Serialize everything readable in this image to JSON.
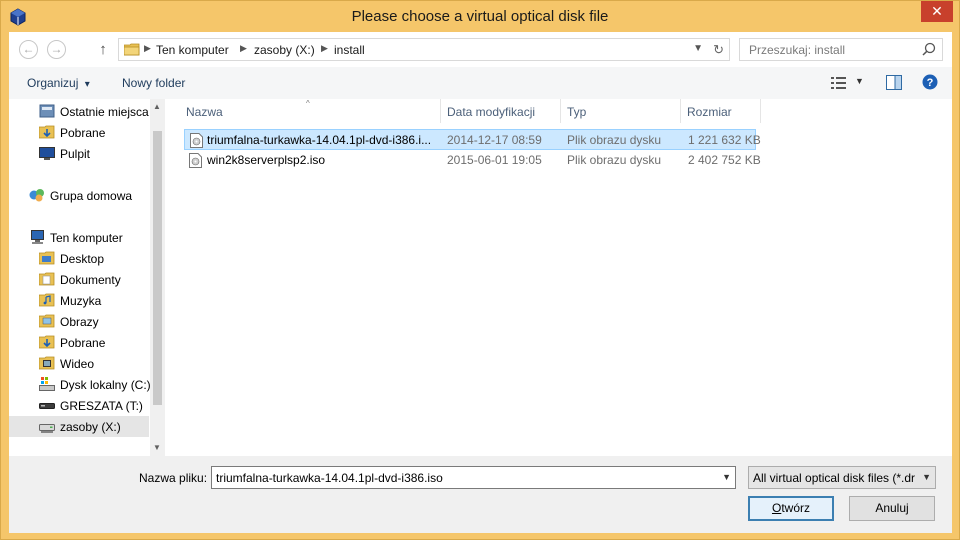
{
  "window": {
    "title": "Please choose a virtual optical disk file",
    "close_label": "✕",
    "app_icon": "virtualbox-icon"
  },
  "navigation": {
    "back_icon": "←",
    "forward_icon": "→",
    "up_icon": "↑",
    "breadcrumbs": [
      "Ten komputer",
      "zasoby (X:)",
      "install"
    ],
    "search_placeholder": "Przeszukaj: install"
  },
  "toolbar": {
    "organize_label": "Organizuj",
    "organize_caret": "▾",
    "new_folder_label": "Nowy folder"
  },
  "nav_pane": {
    "items": [
      {
        "label": "Ostatnie miejsca",
        "icon": "recent-places-icon"
      },
      {
        "label": "Pobrane",
        "icon": "downloads-folder-icon"
      },
      {
        "label": "Pulpit",
        "icon": "desktop-icon"
      },
      {
        "label": "Grupa domowa",
        "icon": "homegroup-icon"
      },
      {
        "label": "Ten komputer",
        "icon": "computer-icon"
      },
      {
        "label": "Desktop",
        "icon": "folder-icon"
      },
      {
        "label": "Dokumenty",
        "icon": "documents-folder-icon"
      },
      {
        "label": "Muzyka",
        "icon": "music-folder-icon"
      },
      {
        "label": "Obrazy",
        "icon": "pictures-folder-icon"
      },
      {
        "label": "Pobrane",
        "icon": "downloads-folder-icon"
      },
      {
        "label": "Wideo",
        "icon": "videos-folder-icon"
      },
      {
        "label": "Dysk lokalny (C:)",
        "icon": "local-disk-icon"
      },
      {
        "label": "GRESZATA (T:)",
        "icon": "drive-icon"
      },
      {
        "label": "zasoby (X:)",
        "icon": "network-drive-icon"
      }
    ]
  },
  "file_list": {
    "columns": [
      "Nazwa",
      "Data modyfikacji",
      "Typ",
      "Rozmiar"
    ],
    "rows": [
      {
        "name": "triumfalna-turkawka-14.04.1pl-dvd-i386.i...",
        "date": "2014-12-17 08:59",
        "type": "Plik obrazu dysku",
        "size": "1 221 632 KB",
        "selected": true
      },
      {
        "name": "win2k8serverplsp2.iso",
        "date": "2015-06-01 19:05",
        "type": "Plik obrazu dysku",
        "size": "2 402 752 KB",
        "selected": false
      }
    ]
  },
  "footer": {
    "filename_label": "Nazwa pliku:",
    "filename_value": "triumfalna-turkawka-14.04.1pl-dvd-i386.iso",
    "filter_value": "All virtual optical disk files (*.dr",
    "open_label_u": "O",
    "open_label_rest": "twórz",
    "cancel_label": "Anuluj"
  },
  "colors": {
    "title_bar": "#f5c66a",
    "close_button": "#c8402c",
    "selection": "#cce8ff",
    "link_text": "#1e3b5c"
  }
}
